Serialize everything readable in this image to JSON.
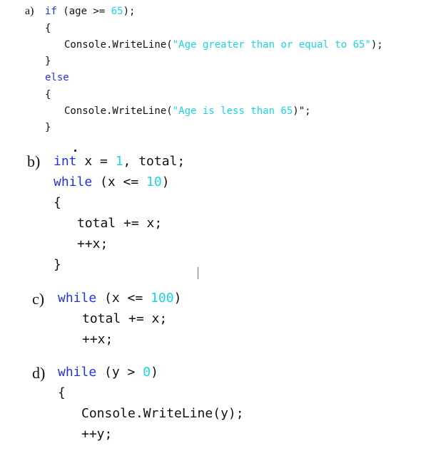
{
  "snippets": {
    "a": {
      "label": "a)",
      "lines": {
        "l1": {
          "kw": "if",
          "t1": " (age >= ",
          "lit": "65",
          "t2": ");"
        },
        "l2": "{",
        "l3": {
          "t1": "Console.WriteLine(",
          "lit": "\"Age greater than or equal to 65\"",
          "t2": ");"
        },
        "l4": "}",
        "l5": {
          "kw": "else"
        },
        "l6": "{",
        "l7": {
          "t1": "Console.WriteLine(",
          "lit": "\"Age is less than 65",
          "t2": ")\";"
        },
        "l8": "}"
      }
    },
    "b": {
      "label": "b)",
      "lines": {
        "l1": {
          "kw": "int",
          "t1": " x = ",
          "lit": "1",
          "t2": ", total;"
        },
        "l2": {
          "kw": "while",
          "t1": " (x <= ",
          "lit": "10",
          "t2": ")"
        },
        "l3": "{",
        "l4": "total += x;",
        "l5": "++x;",
        "l6": "}"
      }
    },
    "c": {
      "label": "c)",
      "lines": {
        "l1": {
          "kw": "while",
          "t1": " (x <= ",
          "lit": "100",
          "t2": ")"
        },
        "l2": "total += x;",
        "l3": "++x;"
      }
    },
    "d": {
      "label": "d)",
      "lines": {
        "l1": {
          "kw": "while",
          "t1": " (y > ",
          "lit": "0",
          "t2": ")"
        },
        "l2": "{",
        "l3": "Console.WriteLine(y);",
        "l4": "++y;"
      }
    }
  },
  "colors": {
    "keyword": "#2233e0",
    "literal": "#1ad6e6",
    "text": "#111111"
  }
}
